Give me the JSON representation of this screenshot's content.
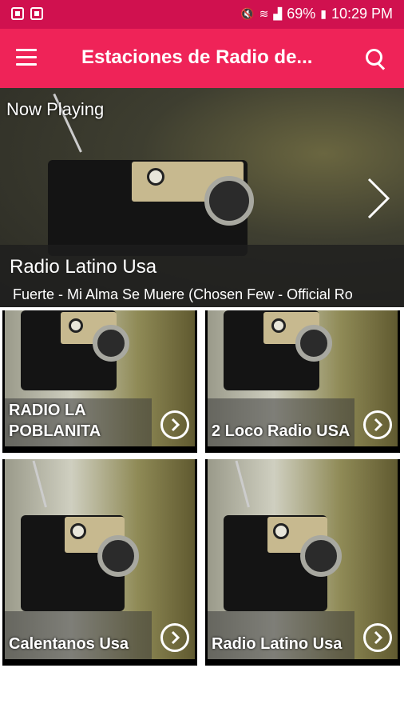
{
  "status_bar": {
    "battery": "69%",
    "time": "10:29 PM"
  },
  "app_bar": {
    "title": "Estaciones de Radio de..."
  },
  "now_playing": {
    "label": "Now Playing",
    "station": "Radio Latino Usa",
    "track": "Fuerte  -  Mi Alma Se Muere (Chosen Few - Official Ro"
  },
  "stations": [
    {
      "name": "RADIO LA POBLANITA"
    },
    {
      "name": "2 Loco Radio USA"
    },
    {
      "name": "Calentanos Usa"
    },
    {
      "name": "Radio Latino Usa"
    }
  ],
  "colors": {
    "status_bar": "#d0114f",
    "app_bar": "#ef2358"
  },
  "icons": {
    "menu": "menu-icon",
    "search": "search-icon",
    "next": "chevron-right-icon",
    "play": "play-circle-icon"
  }
}
